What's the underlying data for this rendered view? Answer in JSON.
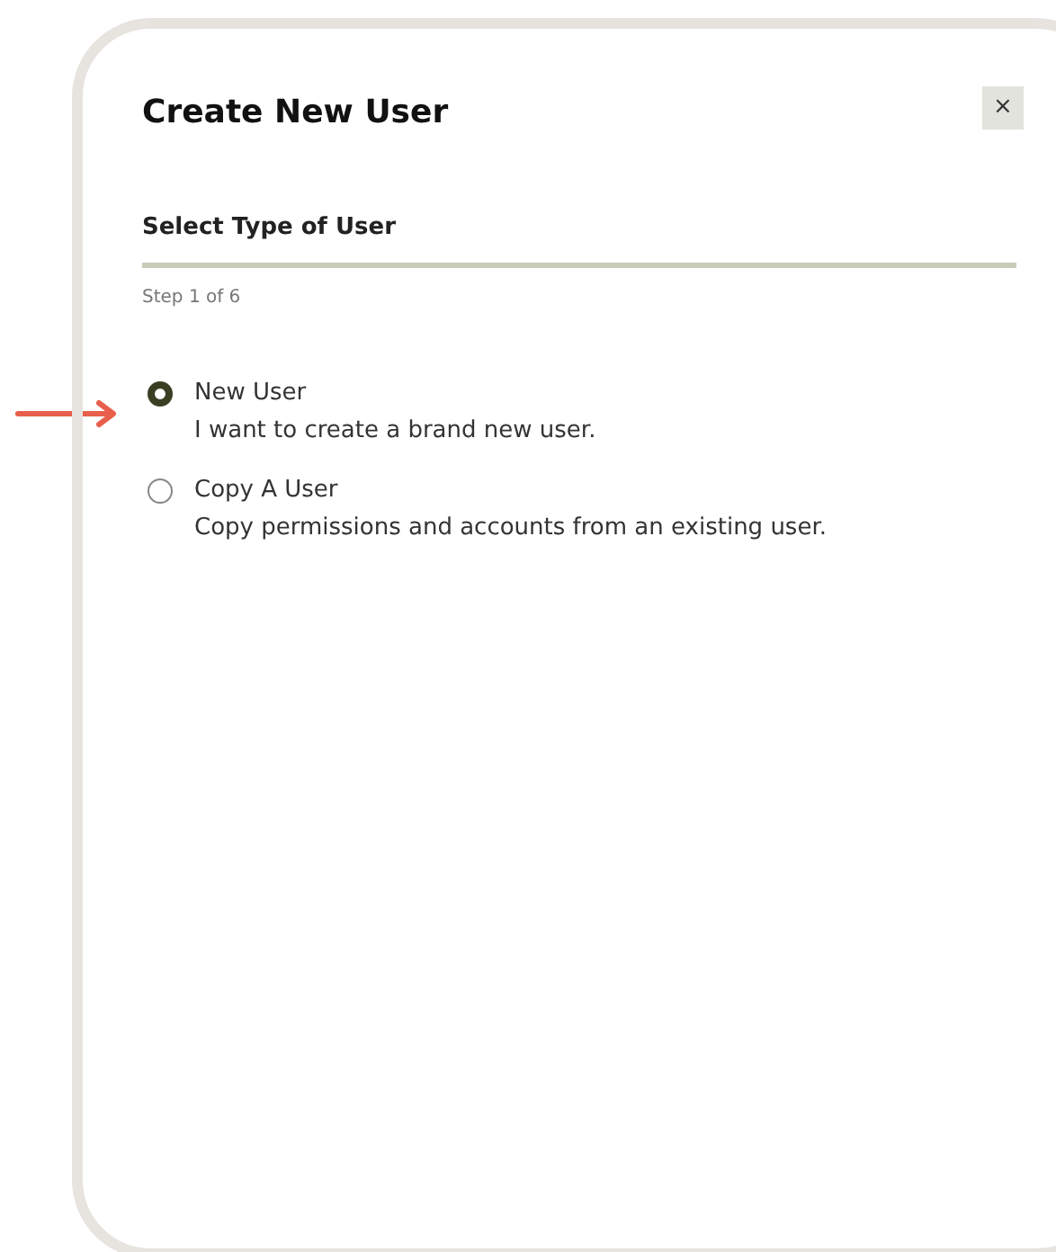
{
  "dialog": {
    "title": "Create New User",
    "close": "×"
  },
  "step": {
    "heading": "Select Type of User",
    "progress": "Step 1 of 6"
  },
  "options": [
    {
      "label": "New User",
      "description": "I want to create a brand new user.",
      "selected": true
    },
    {
      "label": "Copy A User",
      "description": "Copy permissions and accounts from an existing user.",
      "selected": false
    }
  ]
}
